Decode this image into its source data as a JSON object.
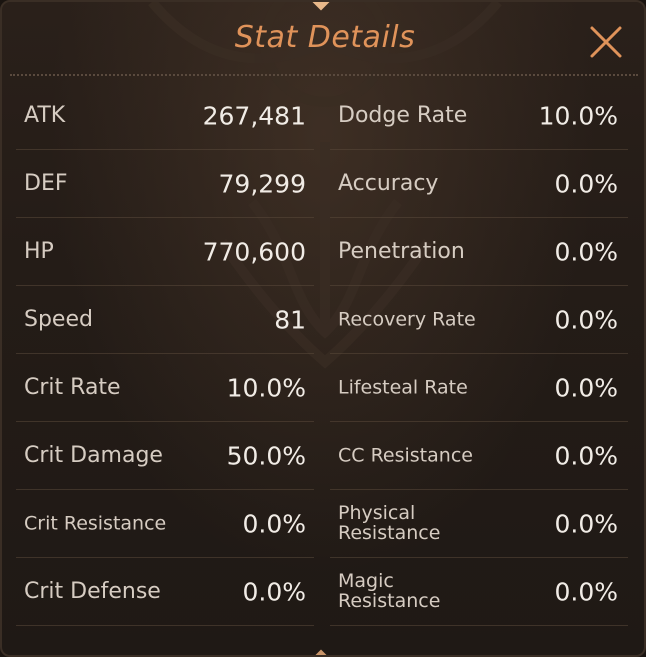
{
  "header": {
    "title": "Stat Details",
    "close_icon": "close-x-icon"
  },
  "colors": {
    "title": "#e0935a",
    "label": "#d6ccc2",
    "value": "#f1ece6",
    "background": "#241c17"
  },
  "stats": {
    "left": [
      {
        "label": "ATK",
        "value": "267,481"
      },
      {
        "label": "DEF",
        "value": "79,299"
      },
      {
        "label": "HP",
        "value": "770,600"
      },
      {
        "label": "Speed",
        "value": "81"
      },
      {
        "label": "Crit Rate",
        "value": "10.0%"
      },
      {
        "label": "Crit Damage",
        "value": "50.0%"
      },
      {
        "label": "Crit Resistance",
        "value": "0.0%"
      },
      {
        "label": "Crit Defense",
        "value": "0.0%"
      }
    ],
    "right": [
      {
        "label": "Dodge Rate",
        "value": "10.0%"
      },
      {
        "label": "Accuracy",
        "value": "0.0%"
      },
      {
        "label": "Penetration",
        "value": "0.0%"
      },
      {
        "label": "Recovery Rate",
        "value": "0.0%"
      },
      {
        "label": "Lifesteal Rate",
        "value": "0.0%"
      },
      {
        "label": "CC Resistance",
        "value": "0.0%"
      },
      {
        "label": "Physical Resistance",
        "value": "0.0%"
      },
      {
        "label": "Magic Resistance",
        "value": "0.0%"
      }
    ]
  }
}
